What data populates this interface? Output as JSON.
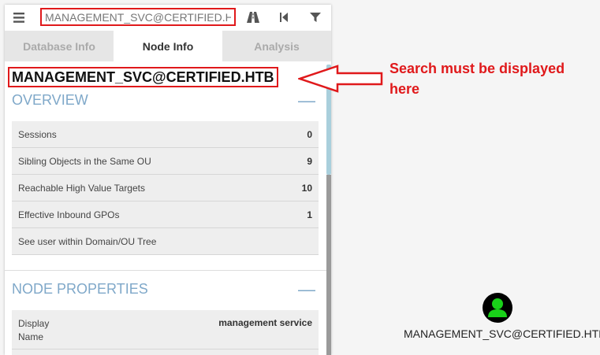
{
  "search": {
    "value": "MANAGEMENT_SVC@CERTIFIED.HTB"
  },
  "toolbar": {
    "menu_icon": "hamburger-menu-icon",
    "pathfinding_icon": "road-icon",
    "back_icon": "skip-back-icon",
    "filter_icon": "filter-icon"
  },
  "tabs": [
    {
      "label": "Database Info"
    },
    {
      "label": "Node Info"
    },
    {
      "label": "Analysis"
    }
  ],
  "node": {
    "title": "MANAGEMENT_SVC@CERTIFIED.HTB"
  },
  "overview": {
    "heading": "OVERVIEW",
    "collapse": "—",
    "rows": [
      {
        "label": "Sessions",
        "value": "0"
      },
      {
        "label": "Sibling Objects in the Same OU",
        "value": "9"
      },
      {
        "label": "Reachable High Value Targets",
        "value": "10"
      },
      {
        "label": "Effective Inbound GPOs",
        "value": "1"
      },
      {
        "label": "See user within Domain/OU Tree",
        "value": ""
      }
    ]
  },
  "node_properties": {
    "heading": "NODE PROPERTIES",
    "collapse": "—",
    "rows": [
      {
        "label": "Display Name",
        "value": "management service"
      }
    ]
  },
  "annotation": {
    "line1": "Search must be displayed",
    "line2": "here",
    "color": "#e0191b"
  },
  "graph": {
    "node_label": "MANAGEMENT_SVC@CERTIFIED.HTB",
    "node_icon": "user-icon",
    "icon_color": "#19d119"
  }
}
